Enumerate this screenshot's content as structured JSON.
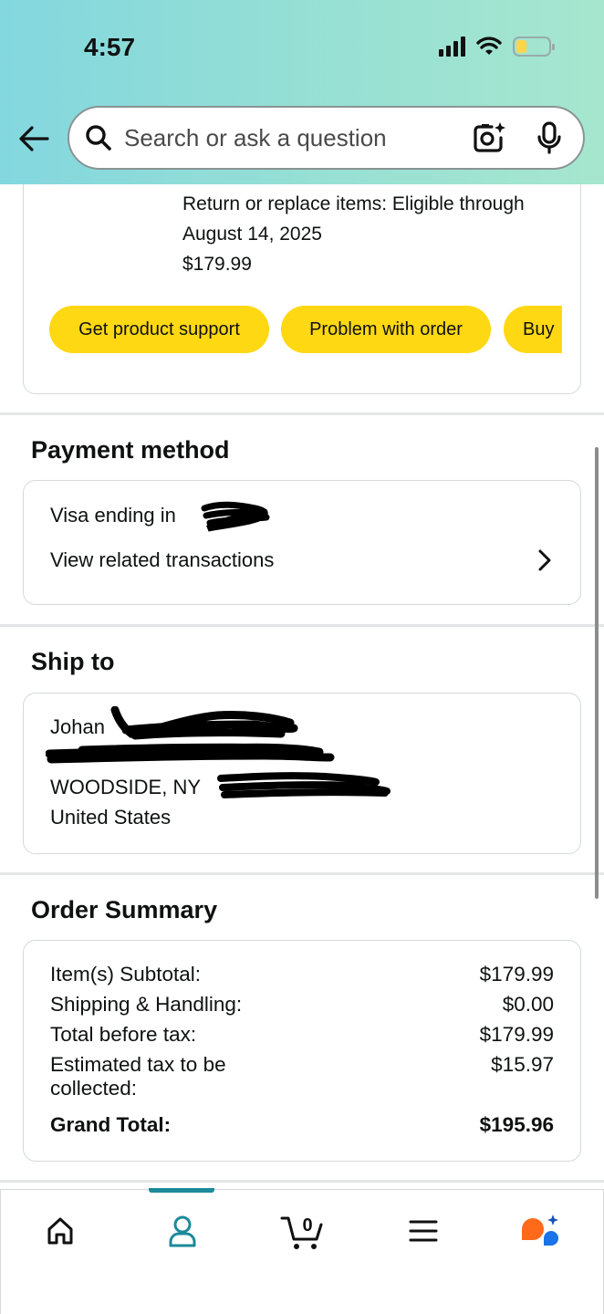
{
  "status_bar": {
    "time": "4:57"
  },
  "search": {
    "placeholder": "Search or ask a question"
  },
  "order_item": {
    "return_line_1": "Return or replace items: Eligible through",
    "return_line_2": "August 14, 2025",
    "price": "$179.99",
    "actions": [
      "Get product support",
      "Problem with order",
      "Buy"
    ]
  },
  "payment": {
    "title": "Payment method",
    "card_label": "Visa  ending in",
    "transactions_link": "View related transactions"
  },
  "ship_to": {
    "title": "Ship to",
    "name": "Johan",
    "city_line": "WOODSIDE, NY",
    "country": "United States"
  },
  "order_summary": {
    "title": "Order Summary",
    "rows": [
      {
        "label": "Item(s) Subtotal:",
        "value": "$179.99"
      },
      {
        "label": "Shipping & Handling:",
        "value": "$0.00"
      },
      {
        "label": "Total before tax:",
        "value": "$179.99"
      },
      {
        "label": "Estimated tax to be",
        "label2": "collected:",
        "value": "$15.97"
      }
    ],
    "grand_total_label": "Grand Total:",
    "grand_total_value": "$195.96"
  },
  "bottom_nav": {
    "cart_count": "0",
    "active": "account",
    "accent_color": "#1c8a9a"
  },
  "colors": {
    "button_yellow": "#ffd814",
    "header_teal": "#8ddbd9"
  }
}
